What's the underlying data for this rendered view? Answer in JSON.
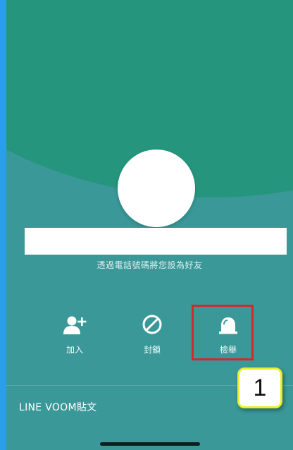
{
  "profile": {
    "subtitle": "透過電話號碼將您設為好友"
  },
  "actions": [
    {
      "label": "加入",
      "icon": "add-friend-icon"
    },
    {
      "label": "封鎖",
      "icon": "block-icon"
    },
    {
      "label": "檢舉",
      "icon": "report-siren-icon"
    }
  ],
  "section": {
    "title": "LINE VOOM貼文"
  },
  "annotation": {
    "step": "1",
    "highlight_color": "#d22a2a",
    "badge_border_color": "#e8ef26"
  },
  "colors": {
    "accent_left_bar": "#2a9ee8",
    "background_teal": "#3a9898",
    "background_green": "#25967d"
  }
}
